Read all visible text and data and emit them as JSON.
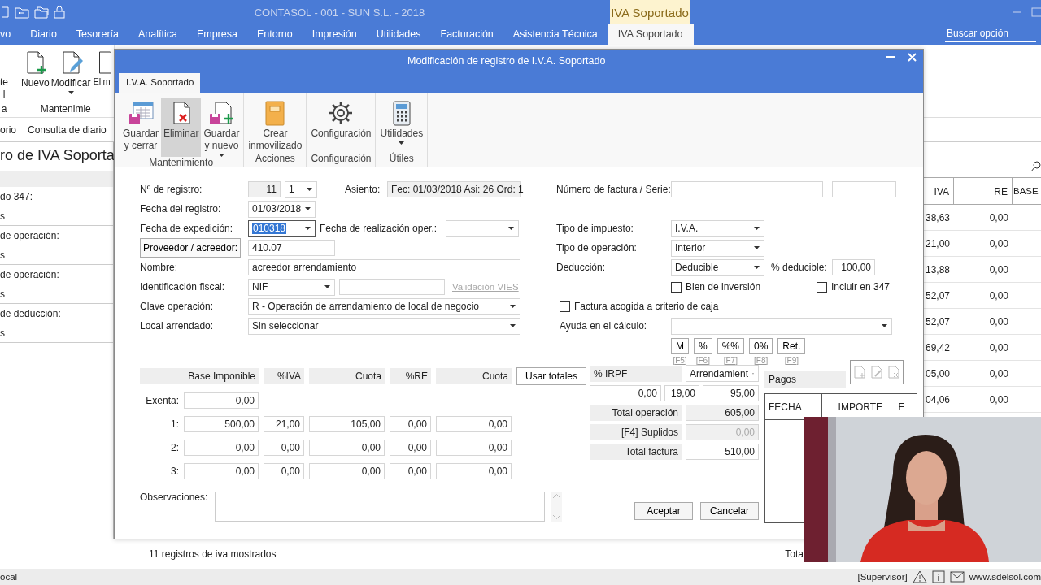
{
  "app": {
    "title": "CONTASOL - 001 - SUN S.L. - 2018",
    "context_tab": "IVA Soportado"
  },
  "menu": [
    {
      "label": "vo",
      "selected": false
    },
    {
      "label": "Diario",
      "selected": false
    },
    {
      "label": "Tesorería",
      "selected": false
    },
    {
      "label": "Analítica",
      "selected": false
    },
    {
      "label": "Empresa",
      "selected": false
    },
    {
      "label": "Entorno",
      "selected": false
    },
    {
      "label": "Impresión",
      "selected": false
    },
    {
      "label": "Utilidades",
      "selected": false
    },
    {
      "label": "Facturación",
      "selected": false
    },
    {
      "label": "Asistencia Técnica",
      "selected": false
    },
    {
      "label": "IVA Soportado",
      "selected": true
    }
  ],
  "search": {
    "placeholder": "Buscar opción"
  },
  "ribbon": [
    {
      "label": "a",
      "buttons": [
        {
          "label": "te\nl",
          "menu": false
        }
      ]
    },
    {
      "label": "Mantenimie",
      "buttons": [
        {
          "label": "Nuevo",
          "menu": false
        },
        {
          "label": "Modificar",
          "menu": true
        },
        {
          "label": "Elim",
          "menu": false
        }
      ]
    }
  ],
  "subtabs": [
    "orio",
    "Consulta de diario"
  ],
  "page_title": "ro de IVA Soporta",
  "filters": [
    {
      "label": "do 347:",
      "value": "s"
    },
    {
      "label": "de operación:",
      "value": "s"
    },
    {
      "label": "de operación:",
      "value": "s"
    },
    {
      "label": "de deducción:",
      "value": "s"
    }
  ],
  "table": {
    "columns": [
      "IVA",
      "RE",
      "BASE"
    ],
    "rows": [
      [
        "38,63",
        "0,00"
      ],
      [
        "21,00",
        "0,00"
      ],
      [
        "13,88",
        "0,00"
      ],
      [
        "52,07",
        "0,00"
      ],
      [
        "52,07",
        "0,00"
      ],
      [
        "69,42",
        "0,00"
      ],
      [
        "05,00",
        "0,00"
      ],
      [
        "04,06",
        "0,00"
      ]
    ]
  },
  "status": {
    "count": "11 registros de iva mostrados",
    "total": "Tota"
  },
  "status_bar": {
    "location": "ocal",
    "user": "[Supervisor]",
    "website": "www.sdelsol.com"
  },
  "dialog": {
    "title": "Modificación de registro de I.V.A. Soportado",
    "tab": "I.V.A. Soportado",
    "ribbon": [
      {
        "label": "Mantenimiento",
        "buttons": [
          {
            "label": "Guardar\ny cerrar",
            "highlighted": false,
            "menu": false
          },
          {
            "label": "Eliminar",
            "highlighted": true,
            "menu": false
          },
          {
            "label": "Guardar\ny nuevo",
            "highlighted": false,
            "menu": true
          }
        ]
      },
      {
        "label": "Acciones",
        "buttons": [
          {
            "label": "Crear\ninmovilizado",
            "highlighted": false,
            "menu": false
          }
        ]
      },
      {
        "label": "Configuración",
        "buttons": [
          {
            "label": "Configuración",
            "highlighted": false,
            "menu": false
          }
        ]
      },
      {
        "label": "Útiles",
        "buttons": [
          {
            "label": "Utilidades",
            "highlighted": false,
            "menu": true
          }
        ]
      }
    ],
    "registro": {
      "label": "Nº de registro:",
      "number": "11",
      "sub": "1",
      "asiento_label": "Asiento:",
      "asiento": "Fec: 01/03/2018 Asi: 26 Ord: 1"
    },
    "fecha_registro": {
      "label": "Fecha del registro:",
      "value": "01/03/2018"
    },
    "fecha_expedicion": {
      "label": "Fecha de expedición:",
      "value": "010318",
      "text_selected": true,
      "realizacion_label": "Fecha de realización oper.:"
    },
    "proveedor": {
      "button": "Proveedor / acreedor:",
      "value": "410.07"
    },
    "nombre": {
      "label": "Nombre:",
      "value": "acreedor arrendamiento"
    },
    "identificacion": {
      "label": "Identificación fiscal:",
      "type": "NIF",
      "link": "Validación VIES",
      "link_disabled": true
    },
    "clave": {
      "label": "Clave operación:",
      "value": "R - Operación de arrendamiento de local de negocio"
    },
    "local": {
      "label": "Local arrendado:",
      "value": "Sin seleccionar"
    },
    "factura": {
      "label": "Número de factura / Serie:"
    },
    "tipo_impuesto": {
      "label": "Tipo de impuesto:",
      "value": "I.V.A."
    },
    "tipo_operacion": {
      "label": "Tipo de operación:",
      "value": "Interior"
    },
    "deduccion": {
      "label": "Deducción:",
      "value": "Deducible",
      "percent_label": "% deducible:",
      "percent": "100,00"
    },
    "checkboxes": [
      {
        "label": "Bien de inversión",
        "checked": false
      },
      {
        "label": "Incluir en 347",
        "checked": false
      },
      {
        "label": "Factura acogida a criterio de caja",
        "checked": false
      }
    ],
    "ayuda": {
      "label": "Ayuda en el cálculo:"
    },
    "calc_buttons": [
      {
        "label": "M",
        "key": "[F5]"
      },
      {
        "label": "%",
        "key": "[F6]"
      },
      {
        "label": "%%",
        "key": "[F7]"
      },
      {
        "label": "0%",
        "key": "[F8]"
      },
      {
        "label": "Ret.",
        "key": "[F9]"
      }
    ],
    "tax": {
      "columns": [
        "Base Imponible",
        "%IVA",
        "Cuota",
        "%RE",
        "Cuota"
      ],
      "button": "Usar totales",
      "rows": [
        {
          "label": "Exenta:",
          "cells": [
            "0,00"
          ]
        },
        {
          "label": "1:",
          "cells": [
            "500,00",
            "21,00",
            "105,00",
            "0,00",
            "0,00"
          ]
        },
        {
          "label": "2:",
          "cells": [
            "0,00",
            "0,00",
            "0,00",
            "0,00",
            "0,00"
          ]
        },
        {
          "label": "3:",
          "cells": [
            "0,00",
            "0,00",
            "0,00",
            "0,00",
            "0,00"
          ]
        }
      ]
    },
    "observaciones": {
      "label": "Observaciones:"
    },
    "irpf": {
      "label": "% IRPF",
      "type": "Arrendamient",
      "values": [
        "0,00",
        "19,00",
        "95,00"
      ]
    },
    "totals": [
      {
        "label": "Total operación",
        "value": "605,00",
        "disabled": false
      },
      {
        "label": "[F4] Suplidos",
        "value": "0,00",
        "disabled": true
      },
      {
        "label": "Total factura",
        "value": "510,00",
        "disabled": false
      }
    ],
    "pagos": {
      "label": "Pagos",
      "columns": [
        "FECHA",
        "IMPORTE",
        "E"
      ]
    },
    "buttons": [
      "Aceptar",
      "Cancelar"
    ]
  },
  "webcam": {
    "kind": "picture"
  }
}
